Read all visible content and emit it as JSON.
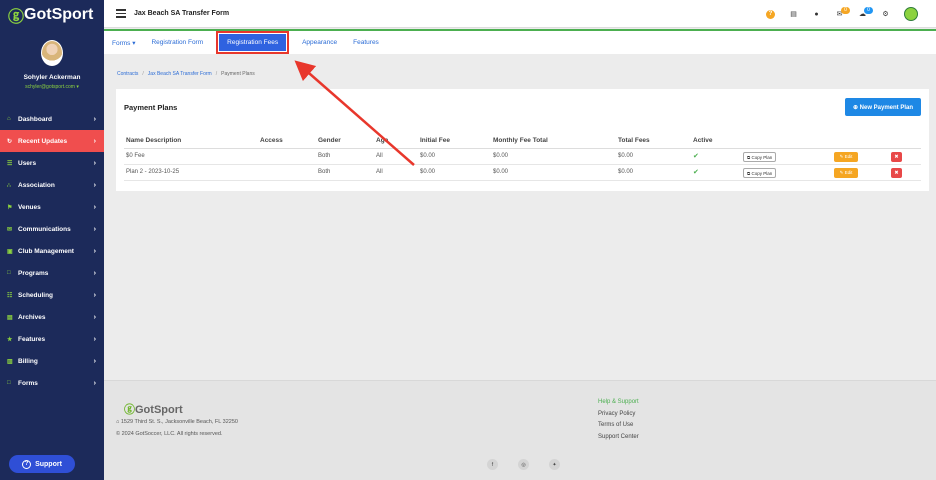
{
  "sidebar": {
    "logo": "GotSport",
    "profile": {
      "name": "Sohyler Ackerman",
      "email": "schyler@gotsport.com ▾"
    },
    "items": [
      {
        "label": "Dashboard",
        "icon": "dashboard-icon",
        "glyph": "⌂"
      },
      {
        "label": "Recent Updates",
        "icon": "refresh-icon",
        "glyph": "↻"
      },
      {
        "label": "Users",
        "icon": "users-icon",
        "glyph": "☰"
      },
      {
        "label": "Association",
        "icon": "sitemap-icon",
        "glyph": "∴"
      },
      {
        "label": "Venues",
        "icon": "map-icon",
        "glyph": "⚑"
      },
      {
        "label": "Communications",
        "icon": "chat-icon",
        "glyph": "✉"
      },
      {
        "label": "Club Management",
        "icon": "club-icon",
        "glyph": "▣"
      },
      {
        "label": "Programs",
        "icon": "document-icon",
        "glyph": "□"
      },
      {
        "label": "Scheduling",
        "icon": "calendar-icon",
        "glyph": "☷"
      },
      {
        "label": "Archives",
        "icon": "archive-icon",
        "glyph": "▤"
      },
      {
        "label": "Features",
        "icon": "star-icon",
        "glyph": "★"
      },
      {
        "label": "Billing",
        "icon": "billing-icon",
        "glyph": "▥"
      },
      {
        "label": "Forms",
        "icon": "form-icon",
        "glyph": "□"
      }
    ],
    "support_label": "Support"
  },
  "topbar": {
    "title": "Jax Beach SA Transfer Form",
    "mail_badge": "0",
    "chat_badge": "0"
  },
  "tabs": [
    {
      "label": "Forms ▾"
    },
    {
      "label": "Registration Form"
    },
    {
      "label": "Registration Fees"
    },
    {
      "label": "Appearance"
    },
    {
      "label": "Features"
    }
  ],
  "breadcrumb": {
    "contracts": "Contracts",
    "form": "Jax Beach SA Transfer Form",
    "current": "Payment Plans"
  },
  "payment_plans": {
    "title": "Payment Plans",
    "new_button": "⊕ New Payment Plan",
    "columns": {
      "name": "Name Description",
      "access": "Access",
      "gender": "Gender",
      "age": "Age",
      "initial": "Initial Fee",
      "monthly": "Monthly Fee Total",
      "total": "Total Fees",
      "active": "Active"
    },
    "rows": [
      {
        "name": "$0 Fee",
        "access": "",
        "gender": "Both",
        "age": "All",
        "initial": "$0.00",
        "monthly": "$0.00",
        "total": "$0.00",
        "active": "✔",
        "copy": "⧉ Copy Plan",
        "edit": "✎ Edit",
        "delete": "✖"
      },
      {
        "name": "Plan 2 - 2023-10-25",
        "access": "",
        "gender": "Both",
        "age": "All",
        "initial": "$0.00",
        "monthly": "$0.00",
        "total": "$0.00",
        "active": "✔",
        "copy": "⧉ Copy Plan",
        "edit": "✎ Edit",
        "delete": "✖"
      }
    ]
  },
  "footer": {
    "logo": "GotSport",
    "address": "⌂ 1529 Third St. S., Jacksonville Beach, FL 32250",
    "copyright": "© 2024 GotSoccer, LLC. All rights reserved.",
    "links": [
      "Help & Support",
      "Privacy Policy",
      "Terms of Use",
      "Support Center"
    ],
    "social": [
      "f",
      "◎",
      "✦"
    ]
  },
  "colors": {
    "sidebar": "#1c2a5a",
    "accent_green": "#8bd23f",
    "active_nav": "#f04e4e",
    "tab_highlight": "#2f62e0",
    "annotation_red": "#e8372c",
    "primary_blue": "#1e88e5"
  }
}
